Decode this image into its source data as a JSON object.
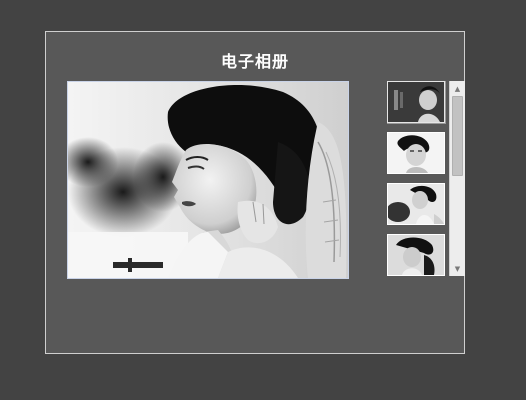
{
  "album": {
    "title": "电子相册"
  },
  "main_photo": {
    "icon": "portrait-photo"
  },
  "thumbnails": [
    {
      "icon": "portrait-thumbnail",
      "selected": true
    },
    {
      "icon": "portrait-thumbnail",
      "selected": false
    },
    {
      "icon": "portrait-thumbnail",
      "selected": false
    },
    {
      "icon": "portrait-thumbnail",
      "selected": false
    }
  ],
  "scrollbar": {
    "up_arrow": "▲",
    "down_arrow": "▼"
  },
  "colors": {
    "page_background": "#434343",
    "panel_background": "#585858",
    "panel_border": "#cfcfcf",
    "title_text": "#ffffff"
  }
}
